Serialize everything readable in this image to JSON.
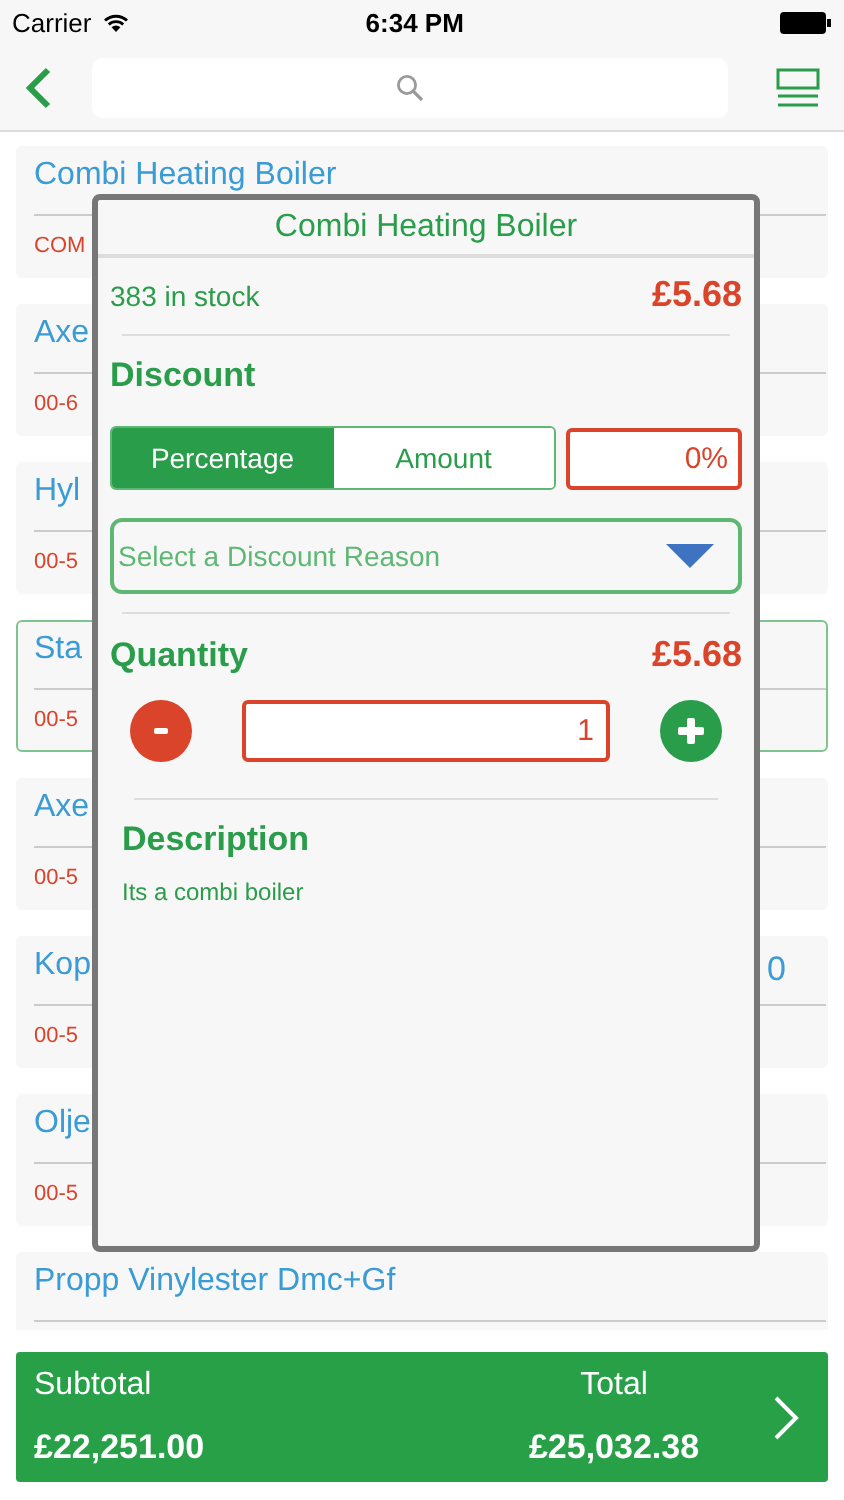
{
  "status_bar": {
    "carrier": "Carrier",
    "time": "6:34 PM"
  },
  "items": [
    {
      "name": "Combi Heating Boiler",
      "code": "COM",
      "selected": false
    },
    {
      "name": "Axe",
      "code": "00-6",
      "selected": false
    },
    {
      "name": "Hyl",
      "code": "00-5",
      "selected": false
    },
    {
      "name": "Sta",
      "code": "00-5",
      "selected": true
    },
    {
      "name": "Axe",
      "code": "00-5",
      "selected": false
    },
    {
      "name": "Kop",
      "code": "00-5",
      "price": "0",
      "selected": false
    },
    {
      "name": "Olje",
      "code": "00-5",
      "selected": false
    },
    {
      "name": "Propp Vinylester Dmc+Gf",
      "selected": false
    }
  ],
  "popup": {
    "title": "Combi Heating Boiler",
    "stock": "383 in stock",
    "price": "£5.68",
    "discount_heading": "Discount",
    "discount_modes": [
      {
        "label": "Percentage",
        "selected": true
      },
      {
        "label": "Amount",
        "selected": false
      }
    ],
    "discount_value": "0%",
    "reason_placeholder": "Select a Discount Reason",
    "quantity_heading": "Quantity",
    "quantity_price": "£5.68",
    "quantity": "1",
    "description_heading": "Description",
    "description": "Its a combi boiler"
  },
  "totals": {
    "subtotal_label": "Subtotal",
    "subtotal": "£22,251.00",
    "total_label": "Total",
    "total": "£25,032.38"
  }
}
